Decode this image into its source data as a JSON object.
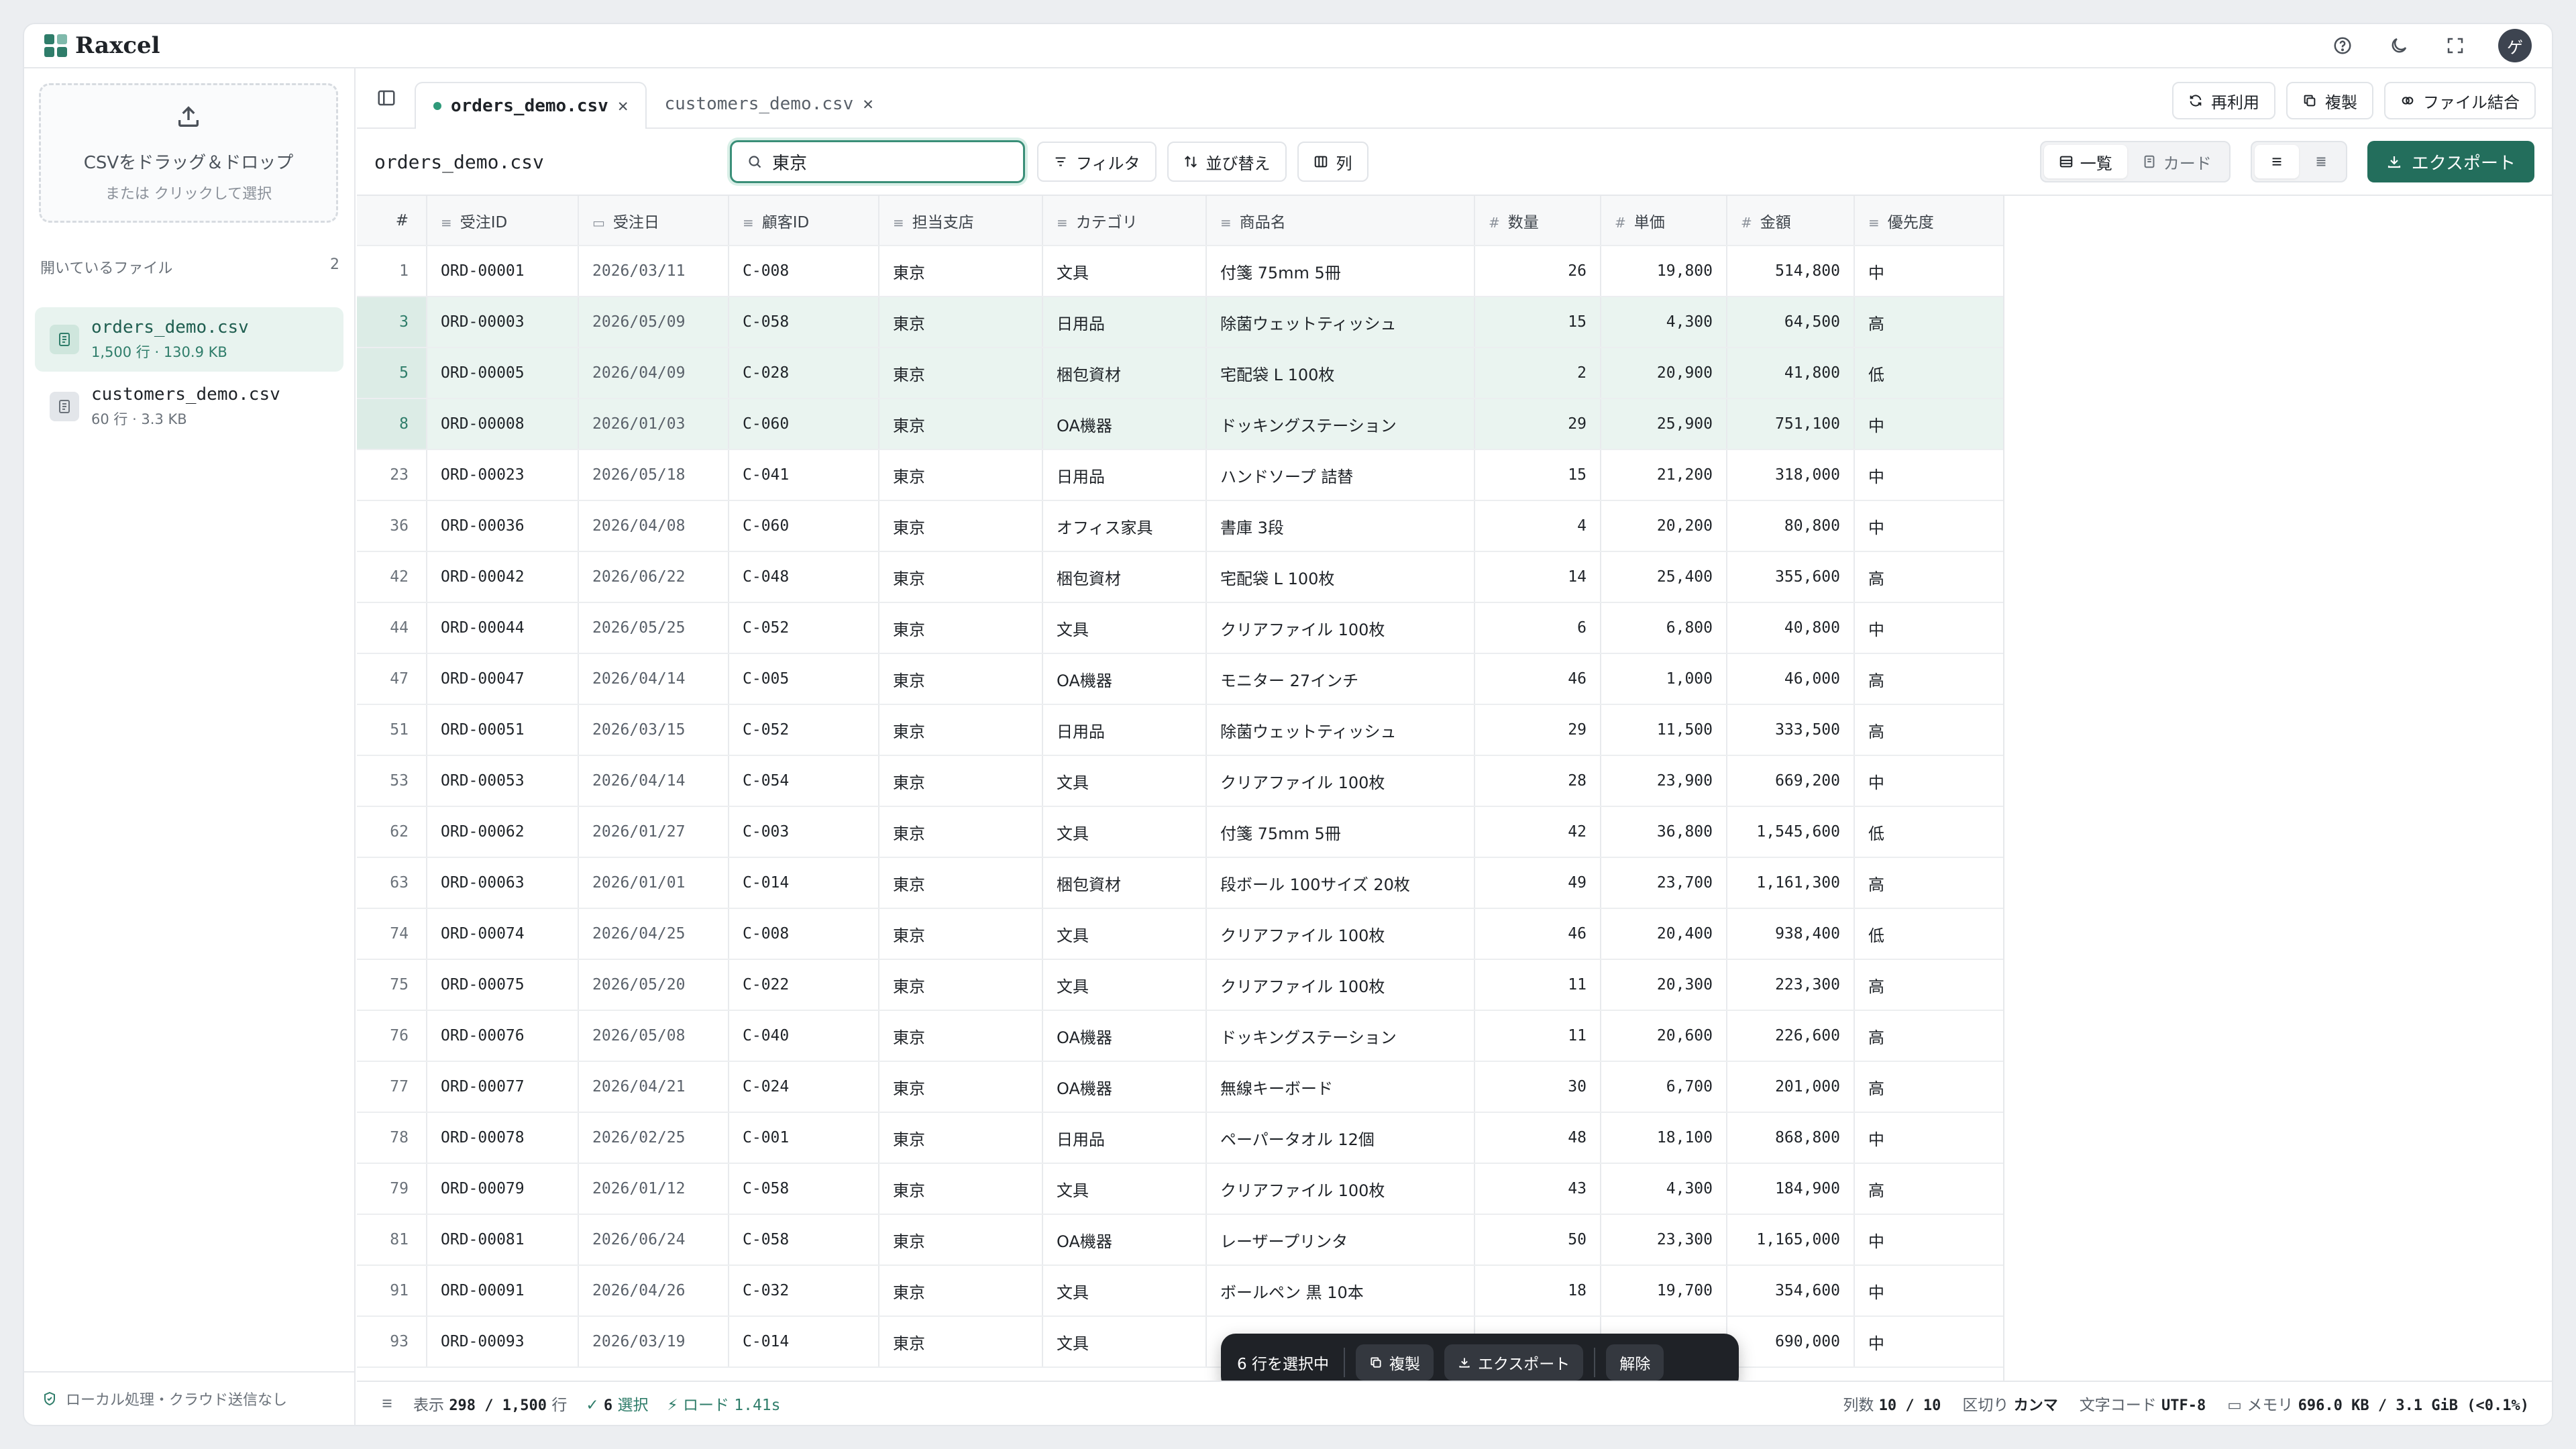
{
  "app": {
    "name": "Raxcel",
    "avatar_initial": "ゲ"
  },
  "sidebar": {
    "drop_main": "CSVをドラッグ＆ドロップ",
    "drop_sub": "または クリックして選択",
    "files_heading": "開いているファイル",
    "files_count": "2",
    "files": [
      {
        "name": "orders_demo.csv",
        "meta": "1,500 行 · 130.9 KB"
      },
      {
        "name": "customers_demo.csv",
        "meta": "60 行 · 3.3 KB"
      }
    ],
    "footer": "ローカル処理・クラウド送信なし"
  },
  "tabs": [
    {
      "label": "orders_demo.csv"
    },
    {
      "label": "customers_demo.csv"
    }
  ],
  "tab_actions": {
    "reuse": "再利用",
    "duplicate": "複製",
    "merge": "ファイル結合"
  },
  "toolbar": {
    "title": "orders_demo.csv",
    "search_value": "東京",
    "filter": "フィルタ",
    "sort": "並び替え",
    "columns": "列",
    "view_list": "一覧",
    "view_card": "カード",
    "export": "エクスポート"
  },
  "table": {
    "headers": [
      "#",
      "受注ID",
      "受注日",
      "顧客ID",
      "担当支店",
      "カテゴリ",
      "商品名",
      "数量",
      "単価",
      "金額",
      "優先度"
    ],
    "rows": [
      [
        "1",
        "ORD-00001",
        "2026/03/11",
        "C-008",
        "東京",
        "文具",
        "付箋 75mm 5冊",
        "26",
        "19,800",
        "514,800",
        "中"
      ],
      [
        "3",
        "ORD-00003",
        "2026/05/09",
        "C-058",
        "東京",
        "日用品",
        "除菌ウェットティッシュ",
        "15",
        "4,300",
        "64,500",
        "高"
      ],
      [
        "5",
        "ORD-00005",
        "2026/04/09",
        "C-028",
        "東京",
        "梱包資材",
        "宅配袋 L 100枚",
        "2",
        "20,900",
        "41,800",
        "低"
      ],
      [
        "8",
        "ORD-00008",
        "2026/01/03",
        "C-060",
        "東京",
        "OA機器",
        "ドッキングステーション",
        "29",
        "25,900",
        "751,100",
        "中"
      ],
      [
        "23",
        "ORD-00023",
        "2026/05/18",
        "C-041",
        "東京",
        "日用品",
        "ハンドソープ 詰替",
        "15",
        "21,200",
        "318,000",
        "中"
      ],
      [
        "36",
        "ORD-00036",
        "2026/04/08",
        "C-060",
        "東京",
        "オフィス家具",
        "書庫 3段",
        "4",
        "20,200",
        "80,800",
        "中"
      ],
      [
        "42",
        "ORD-00042",
        "2026/06/22",
        "C-048",
        "東京",
        "梱包資材",
        "宅配袋 L 100枚",
        "14",
        "25,400",
        "355,600",
        "高"
      ],
      [
        "44",
        "ORD-00044",
        "2026/05/25",
        "C-052",
        "東京",
        "文具",
        "クリアファイル 100枚",
        "6",
        "6,800",
        "40,800",
        "中"
      ],
      [
        "47",
        "ORD-00047",
        "2026/04/14",
        "C-005",
        "東京",
        "OA機器",
        "モニター 27インチ",
        "46",
        "1,000",
        "46,000",
        "高"
      ],
      [
        "51",
        "ORD-00051",
        "2026/03/15",
        "C-052",
        "東京",
        "日用品",
        "除菌ウェットティッシュ",
        "29",
        "11,500",
        "333,500",
        "高"
      ],
      [
        "53",
        "ORD-00053",
        "2026/04/14",
        "C-054",
        "東京",
        "文具",
        "クリアファイル 100枚",
        "28",
        "23,900",
        "669,200",
        "中"
      ],
      [
        "62",
        "ORD-00062",
        "2026/01/27",
        "C-003",
        "東京",
        "文具",
        "付箋 75mm 5冊",
        "42",
        "36,800",
        "1,545,600",
        "低"
      ],
      [
        "63",
        "ORD-00063",
        "2026/01/01",
        "C-014",
        "東京",
        "梱包資材",
        "段ボール 100サイズ 20枚",
        "49",
        "23,700",
        "1,161,300",
        "高"
      ],
      [
        "74",
        "ORD-00074",
        "2026/04/25",
        "C-008",
        "東京",
        "文具",
        "クリアファイル 100枚",
        "46",
        "20,400",
        "938,400",
        "低"
      ],
      [
        "75",
        "ORD-00075",
        "2026/05/20",
        "C-022",
        "東京",
        "文具",
        "クリアファイル 100枚",
        "11",
        "20,300",
        "223,300",
        "高"
      ],
      [
        "76",
        "ORD-00076",
        "2026/05/08",
        "C-040",
        "東京",
        "OA機器",
        "ドッキングステーション",
        "11",
        "20,600",
        "226,600",
        "高"
      ],
      [
        "77",
        "ORD-00077",
        "2026/04/21",
        "C-024",
        "東京",
        "OA機器",
        "無線キーボード",
        "30",
        "6,700",
        "201,000",
        "高"
      ],
      [
        "78",
        "ORD-00078",
        "2026/02/25",
        "C-001",
        "東京",
        "日用品",
        "ペーパータオル 12個",
        "48",
        "18,100",
        "868,800",
        "中"
      ],
      [
        "79",
        "ORD-00079",
        "2026/01/12",
        "C-058",
        "東京",
        "文具",
        "クリアファイル 100枚",
        "43",
        "4,300",
        "184,900",
        "高"
      ],
      [
        "81",
        "ORD-00081",
        "2026/06/24",
        "C-058",
        "東京",
        "OA機器",
        "レーザープリンタ",
        "50",
        "23,300",
        "1,165,000",
        "中"
      ],
      [
        "91",
        "ORD-00091",
        "2026/04/26",
        "C-032",
        "東京",
        "文具",
        "ボールペン 黒 10本",
        "18",
        "19,700",
        "354,600",
        "中"
      ],
      [
        "93",
        "ORD-00093",
        "2026/03/19",
        "C-014",
        "東京",
        "文具",
        "",
        "",
        "",
        "690,000",
        "中"
      ]
    ],
    "selected_row_indexes": [
      1,
      2,
      3
    ]
  },
  "floatbar": {
    "selected": "6 行を選択中",
    "duplicate": "複製",
    "export": "エクスポート",
    "clear": "解除"
  },
  "status": {
    "shown_label": "表示",
    "shown_value": "298 / 1,500",
    "shown_unit": "行",
    "selected_value": "6",
    "selected_label": "選択",
    "load_label": "ロード",
    "load_value": "1.41s",
    "cols_label": "列数",
    "cols_value": "10 / 10",
    "delim_label": "区切り",
    "delim_value": "カンマ",
    "enc_label": "文字コード",
    "enc_value": "UTF-8",
    "mem_label": "メモリ",
    "mem_value": "696.0 KB / 3.1 GiB (<0.1%)"
  },
  "colors": {
    "accent": "#236e5c",
    "selected_row": "#eaf4f0"
  }
}
